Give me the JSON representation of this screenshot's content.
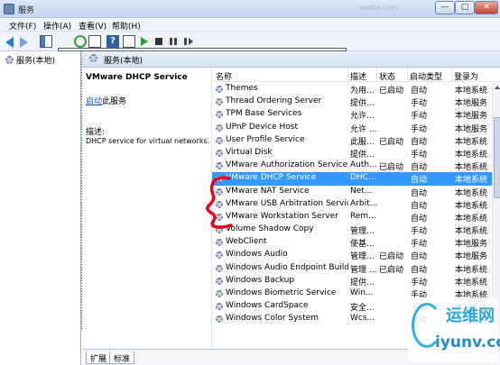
{
  "window": {
    "title": "服务",
    "ghost_text": "weibo.com",
    "min": "—",
    "max": "□",
    "close": "✕"
  },
  "menu": [
    "文件(F)",
    "操作(A)",
    "查看(V)",
    "帮助(H)"
  ],
  "tree": {
    "root": "服务(本地)"
  },
  "pane": {
    "title": "服务(本地)"
  },
  "detail": {
    "service_name": "VMware DHCP Service",
    "start_link": "启动",
    "start_suffix": "此服务",
    "desc_label": "描述:",
    "desc_text": "DHCP service for virtual networks."
  },
  "columns": {
    "name": "名称",
    "desc": "描述",
    "status": "状态",
    "type": "启动类型",
    "logon": "登录为"
  },
  "services": [
    {
      "name": "Themes",
      "desc": "为用...",
      "status": "已启动",
      "type": "自动",
      "logon": "本地系统"
    },
    {
      "name": "Thread Ordering Server",
      "desc": "提供...",
      "status": "",
      "type": "手动",
      "logon": "本地服务"
    },
    {
      "name": "TPM Base Services",
      "desc": "允许...",
      "status": "",
      "type": "手动",
      "logon": "本地服务"
    },
    {
      "name": "UPnP Device Host",
      "desc": "允许 ...",
      "status": "",
      "type": "手动",
      "logon": "本地服务"
    },
    {
      "name": "User Profile Service",
      "desc": "此服...",
      "status": "已启动",
      "type": "自动",
      "logon": "本地系统"
    },
    {
      "name": "Virtual Disk",
      "desc": "提供...",
      "status": "",
      "type": "手动",
      "logon": "本地系统"
    },
    {
      "name": "VMware Authorization Service",
      "desc": "Auth...",
      "status": "已启动",
      "type": "自动",
      "logon": "本地系统"
    },
    {
      "name": "VMware DHCP Service",
      "desc": "DHC...",
      "status": "",
      "type": "自动",
      "logon": "本地系统",
      "selected": true
    },
    {
      "name": "VMware NAT Service",
      "desc": "Net...",
      "status": "",
      "type": "自动",
      "logon": "本地系统"
    },
    {
      "name": "VMware USB Arbitration Service",
      "desc": "Arbit...",
      "status": "",
      "type": "自动",
      "logon": "本地系统"
    },
    {
      "name": "VMware Workstation Server",
      "desc": "Rem...",
      "status": "",
      "type": "自动",
      "logon": "本地系统"
    },
    {
      "name": "Volume Shadow Copy",
      "desc": "管理...",
      "status": "",
      "type": "手动",
      "logon": "本地系统"
    },
    {
      "name": "WebClient",
      "desc": "使基...",
      "status": "",
      "type": "手动",
      "logon": "本地服务"
    },
    {
      "name": "Windows Audio",
      "desc": "管理...",
      "status": "已启动",
      "type": "自动",
      "logon": "本地服务"
    },
    {
      "name": "Windows Audio Endpoint Builder",
      "desc": "管理 ...",
      "status": "已启动",
      "type": "自动",
      "logon": "本地系统"
    },
    {
      "name": "Windows Backup",
      "desc": "提供...",
      "status": "",
      "type": "手动",
      "logon": "本地系统"
    },
    {
      "name": "Windows Biometric Service",
      "desc": "Win...",
      "status": "",
      "type": "手动",
      "logon": "本地系统"
    },
    {
      "name": "Windows CardSpace",
      "desc": "安全...",
      "status": "",
      "type": "手动",
      "logon": "本地系统"
    },
    {
      "name": "Windows Color System",
      "desc": "Wcs...",
      "status": "",
      "type": "手动",
      "logon": "本地服务"
    }
  ],
  "tabs": [
    "扩展",
    "标准"
  ],
  "watermark": {
    "cn": "运维网",
    "en": "iyunv.com"
  },
  "colors": {
    "selection": "#3399ff",
    "link": "#1a56b8",
    "annotation": "#e0001a"
  }
}
